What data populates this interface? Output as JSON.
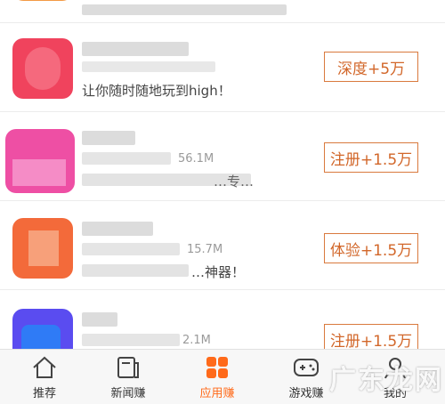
{
  "rows": [
    {
      "subtitle": "让你随时随地玩到high！",
      "meta": "",
      "button": "深度+5万"
    },
    {
      "subtitle": "…专…",
      "meta": "56.1M",
      "button": "注册+1.5万"
    },
    {
      "subtitle": "…神器！",
      "meta": "15.7M",
      "button": "体验+1.5万"
    },
    {
      "subtitle": "",
      "meta": "2.1M",
      "button": "注册+1.5万"
    }
  ],
  "tabs": [
    {
      "label": "推荐",
      "icon": "home-icon"
    },
    {
      "label": "新闻赚",
      "icon": "news-icon"
    },
    {
      "label": "应用赚",
      "icon": "apps-icon"
    },
    {
      "label": "游戏赚",
      "icon": "gamepad-icon"
    },
    {
      "label": "我的",
      "icon": "profile-icon"
    }
  ],
  "watermark": "广东龙网",
  "colors": {
    "accent": "#ff6a1a",
    "button_border": "#d97a3e"
  }
}
